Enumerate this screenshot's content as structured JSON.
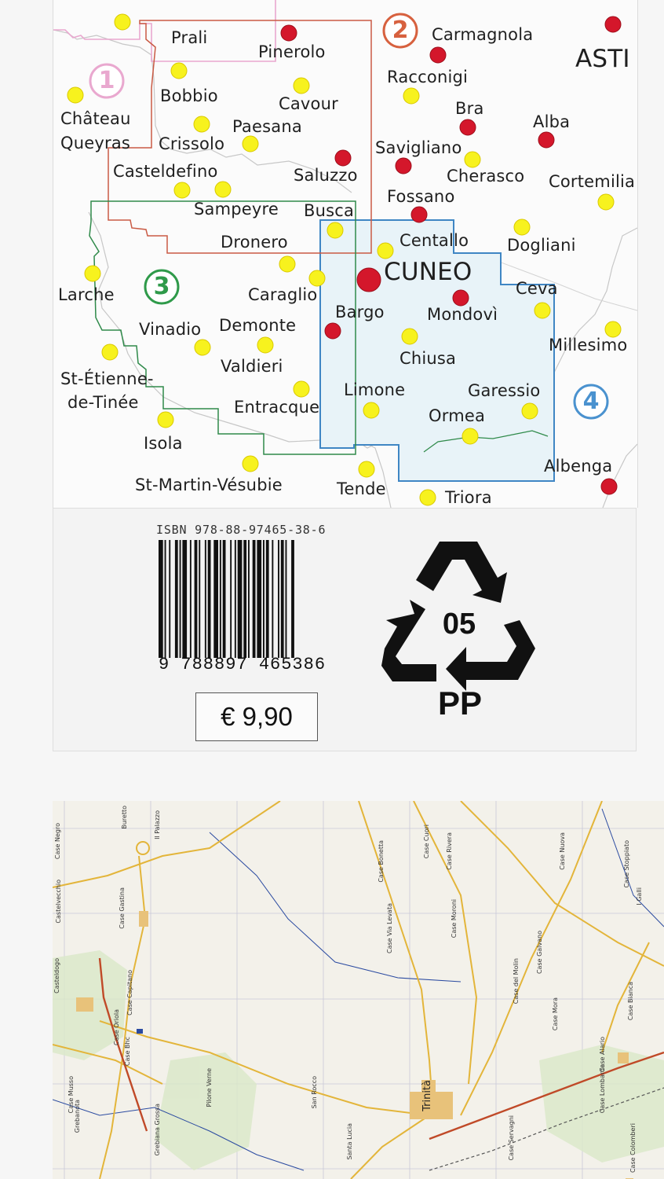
{
  "overview": {
    "towns": [
      {
        "name": "Prali",
        "marker": "yellow"
      },
      {
        "name": "Pinerolo",
        "marker": "red"
      },
      {
        "name": "Carmagnola",
        "marker": "red"
      },
      {
        "name": "ASTI",
        "marker": "red"
      },
      {
        "name": "Racconigi",
        "marker": "yellow"
      },
      {
        "name": "Bobbio",
        "marker": "yellow"
      },
      {
        "name": "Cavour",
        "marker": "yellow"
      },
      {
        "name": "Château",
        "marker": "yellow"
      },
      {
        "name": "Queyras",
        "marker": "none"
      },
      {
        "name": "Paesana",
        "marker": "yellow"
      },
      {
        "name": "Bra",
        "marker": "red"
      },
      {
        "name": "Alba",
        "marker": "red"
      },
      {
        "name": "Crissolo",
        "marker": "yellow"
      },
      {
        "name": "Savigliano",
        "marker": "red"
      },
      {
        "name": "Cherasco",
        "marker": "yellow"
      },
      {
        "name": "Casteldefino",
        "marker": "yellow"
      },
      {
        "name": "Saluzzo",
        "marker": "red"
      },
      {
        "name": "Cortemilia",
        "marker": "yellow"
      },
      {
        "name": "Fossano",
        "marker": "red"
      },
      {
        "name": "Sampeyre",
        "marker": "yellow"
      },
      {
        "name": "Busca",
        "marker": "yellow"
      },
      {
        "name": "Dronero",
        "marker": "yellow"
      },
      {
        "name": "Centallo",
        "marker": "yellow"
      },
      {
        "name": "Dogliani",
        "marker": "yellow"
      },
      {
        "name": "CUNEO",
        "marker": "red-big"
      },
      {
        "name": "Larche",
        "marker": "yellow"
      },
      {
        "name": "Caraglio",
        "marker": "yellow"
      },
      {
        "name": "Ceva",
        "marker": "yellow"
      },
      {
        "name": "Bargo",
        "marker": "red"
      },
      {
        "name": "Mondovì",
        "marker": "red"
      },
      {
        "name": "Vinadio",
        "marker": "yellow"
      },
      {
        "name": "Demonte",
        "marker": "yellow"
      },
      {
        "name": "Millesimo",
        "marker": "yellow"
      },
      {
        "name": "Chiusa",
        "marker": "yellow"
      },
      {
        "name": "Valdieri",
        "marker": "yellow"
      },
      {
        "name": "St-Étienne-",
        "marker": "yellow"
      },
      {
        "name": "de-Tinée",
        "marker": "none"
      },
      {
        "name": "Limone",
        "marker": "yellow"
      },
      {
        "name": "Garessio",
        "marker": "yellow"
      },
      {
        "name": "Entracque",
        "marker": "yellow"
      },
      {
        "name": "Ormea",
        "marker": "yellow"
      },
      {
        "name": "Isola",
        "marker": "yellow"
      },
      {
        "name": "Albenga",
        "marker": "red"
      },
      {
        "name": "St-Martin-Vésubie",
        "marker": "yellow"
      },
      {
        "name": "Tende",
        "marker": "yellow"
      },
      {
        "name": "Triora",
        "marker": "yellow"
      }
    ],
    "zones": [
      {
        "number": "1",
        "color": "#e9a8cf"
      },
      {
        "number": "2",
        "color": "#d7613f"
      },
      {
        "number": "3",
        "color": "#2f9a4a"
      },
      {
        "number": "4",
        "color": "#4a92cf"
      }
    ]
  },
  "product": {
    "isbn_label": "ISBN  978-88-97465-38-6",
    "ean_digits": "9  788897  465386",
    "price": "€ 9,90",
    "recycling_code": "05",
    "recycling_material": "PP"
  },
  "detail_map": {
    "labels": [
      "Case Negro",
      "Buretto",
      "Il Palazzo",
      "Case Gastina",
      "Castelvecchio",
      "Casteldogo",
      "Case Capitano",
      "Case Oriola",
      "Case Musso",
      "Case Bhc",
      "Grebanota",
      "Grebiana Grossa",
      "Pilone Verne",
      "San Rocco",
      "Santa Lucia",
      "Trinità",
      "Case Cuori",
      "Case Rivera",
      "Case Bonetta",
      "Case Via Levata",
      "Case Moroni",
      "Case del Molin",
      "Case Galvano",
      "Case Mora",
      "Case Nuova",
      "Case Stoppiato",
      "I Galli",
      "Case Bianca",
      "Case Lombardo",
      "Case Colomberi",
      "Case Alario",
      "Case Servagni"
    ]
  }
}
